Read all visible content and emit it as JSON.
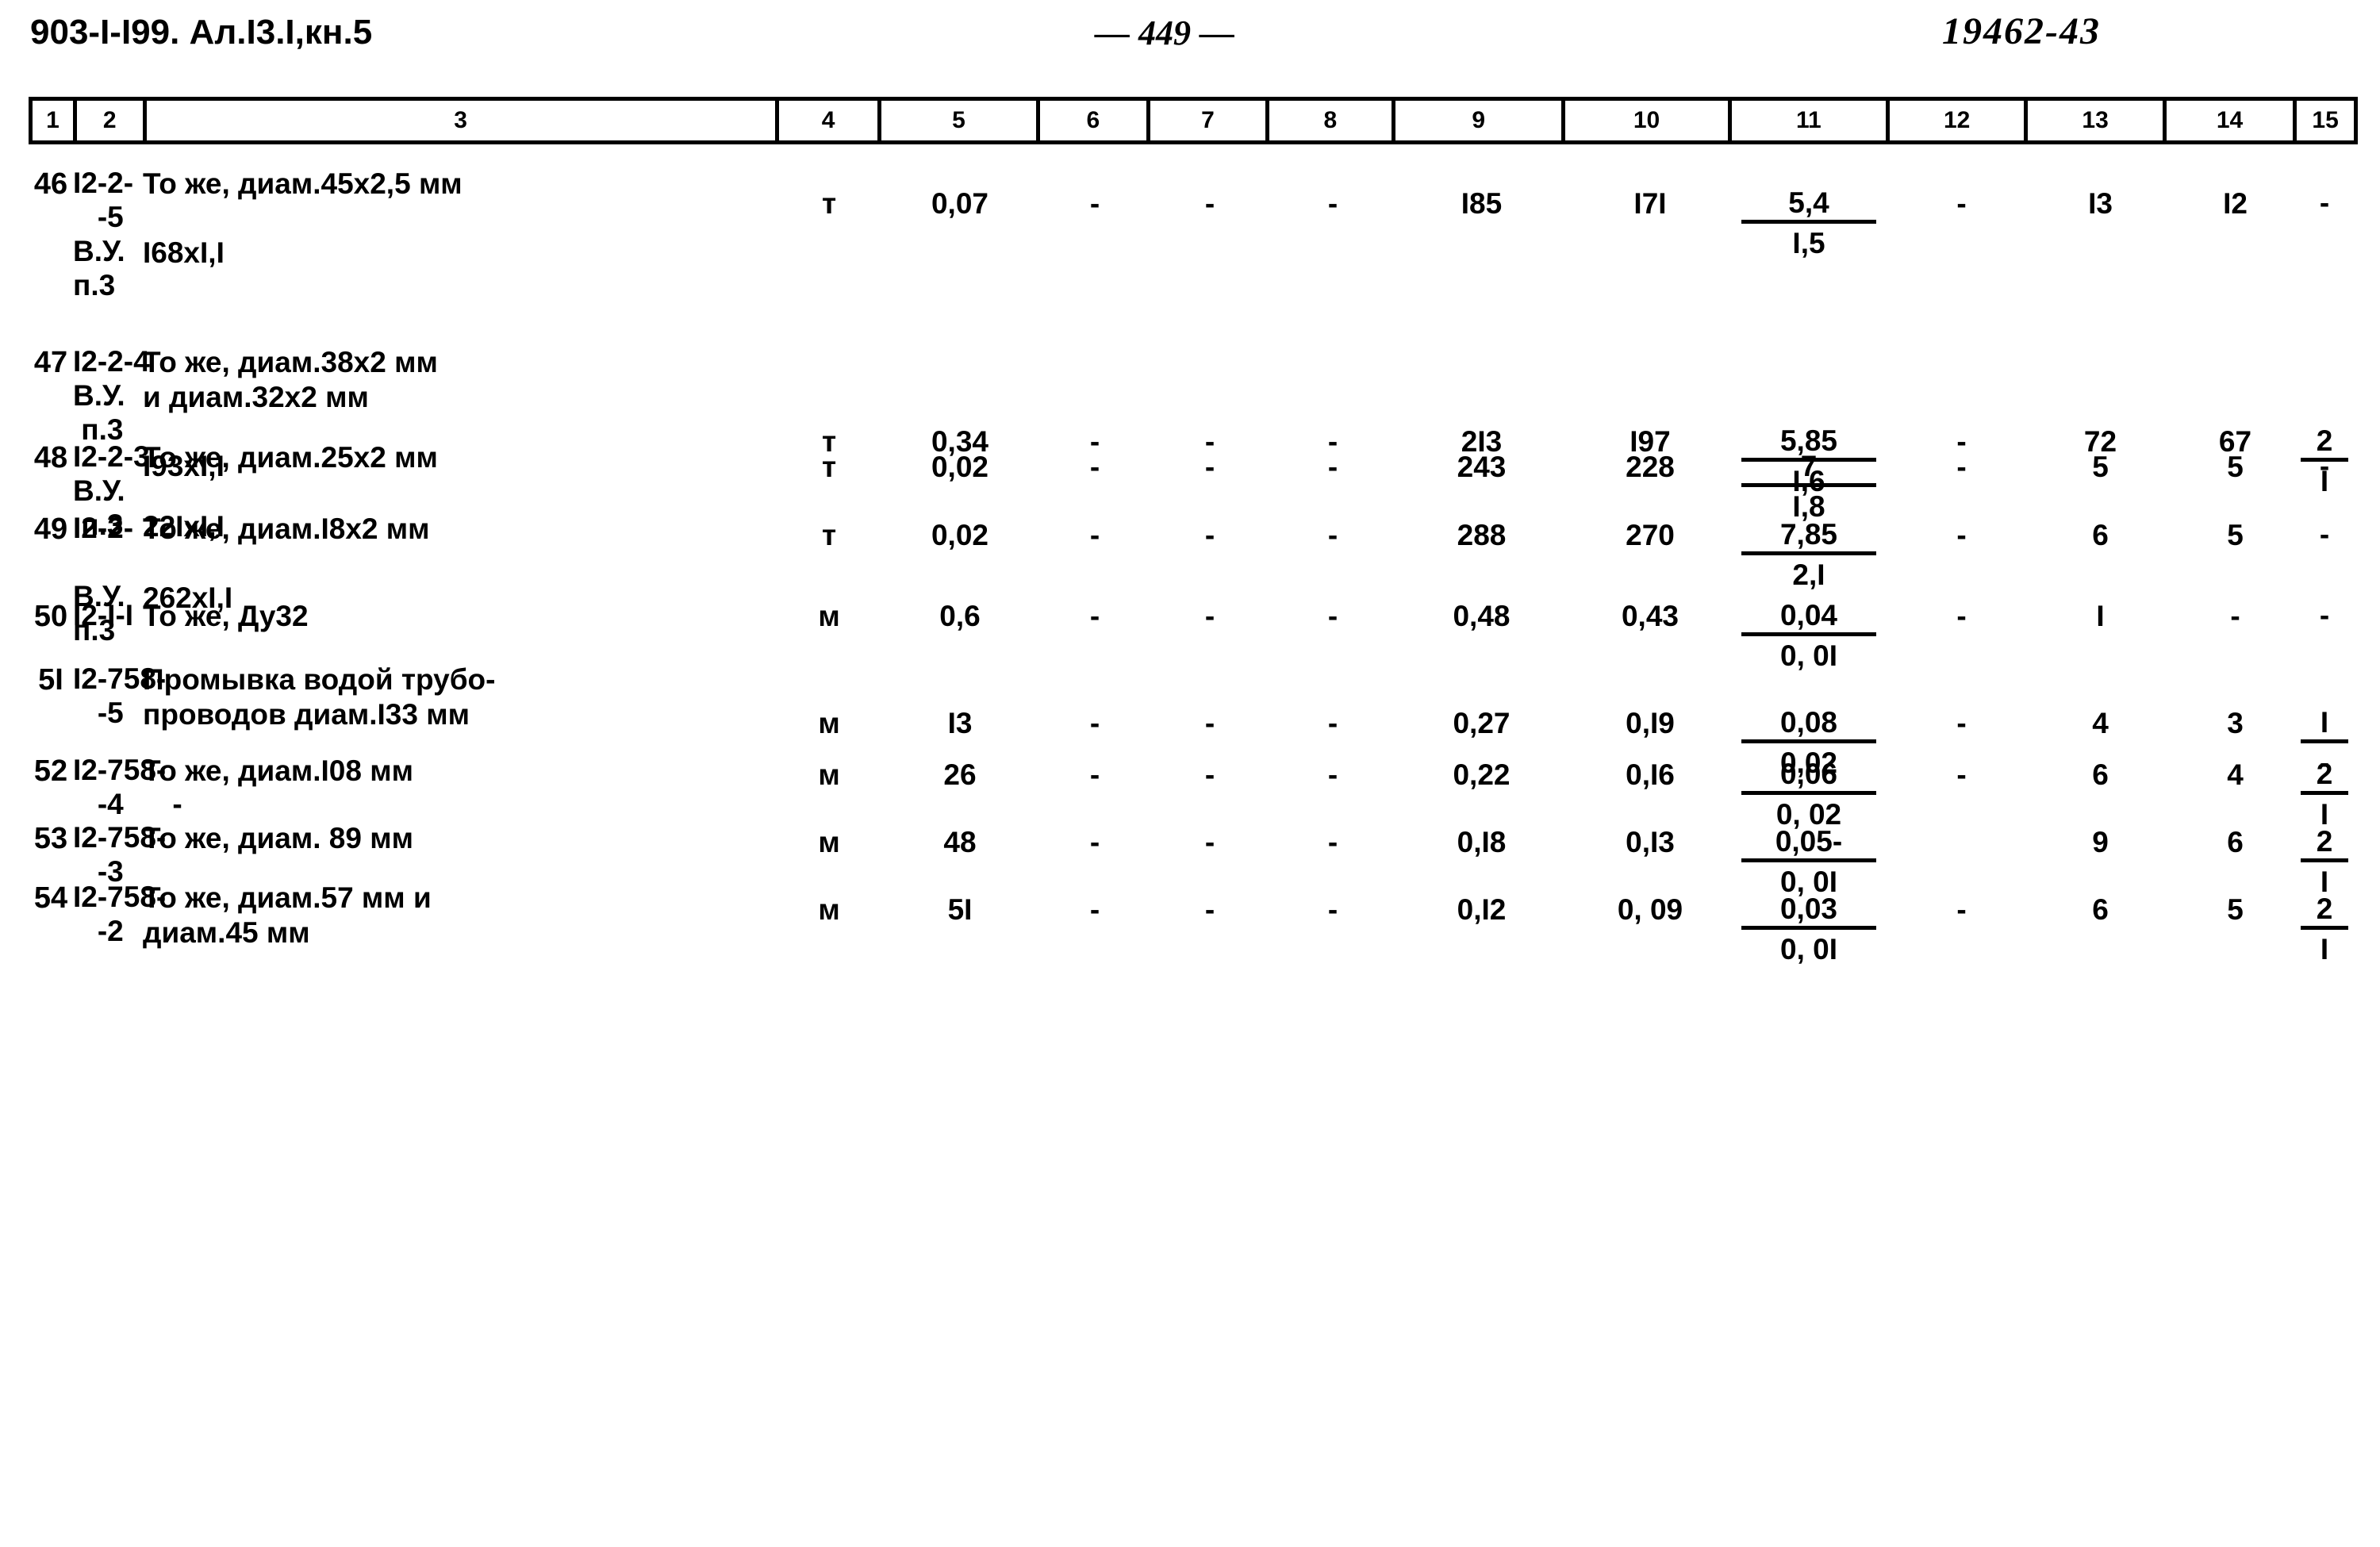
{
  "header": {
    "doc_code": "903-I-I99. Ал.I3.I,кн.5",
    "page_number": "— 449 —",
    "stamp": "19462-43"
  },
  "table": {
    "column_numbers": [
      "1",
      "2",
      "3",
      "4",
      "5",
      "6",
      "7",
      "8",
      "9",
      "10",
      "11",
      "12",
      "13",
      "14",
      "15"
    ],
    "rows": [
      {
        "n": "46",
        "code": "I2-2-\n   -5\nВ.У.\nп.3",
        "desc": "То же, диам.45х2,5 мм\n\nI68хI,I",
        "unit": "т",
        "c5": "0,07",
        "c6": "-",
        "c7": "-",
        "c8": "-",
        "c9": "I85",
        "c10": "I7I",
        "c11_top": "5,4",
        "c11_bot": "I,5",
        "c12": "-",
        "c13": "I3",
        "c14": "I2",
        "c15_top": "-",
        "c15_bot": ""
      },
      {
        "n": "47",
        "code": "I2-2-4\nВ.У.\n п.3",
        "desc": "То же, диам.38х2 мм\nи диам.32х2 мм\n\nI93хI,I",
        "unit": "т",
        "c5": "0,34",
        "c6": "-",
        "c7": "-",
        "c8": "-",
        "c9": "2I3",
        "c10": "I97",
        "c11_top": "5,85",
        "c11_bot": "I,6",
        "c12": "-",
        "c13": "72",
        "c14": "67",
        "c15_top": "2",
        "c15_bot": "I"
      },
      {
        "n": "48",
        "code": "I2-2-3\nВ.У.\n п.3",
        "desc": "То же, диам.25х2 мм\n\n22IхI,I",
        "unit": "т",
        "c5": "0,02",
        "c6": "-",
        "c7": "-",
        "c8": "-",
        "c9": "243",
        "c10": "228",
        "c11_top": "7",
        "c11_bot": "I,8",
        "c12": "-",
        "c13": "5",
        "c14": "5",
        "c15_top": "-",
        "c15_bot": ""
      },
      {
        "n": "49",
        "code": "I2-2-\n\nВ.У.\nп.3",
        "desc": "То же, диам.I8х2 мм\n\n262хI,I",
        "unit": "т",
        "c5": "0,02",
        "c6": "-",
        "c7": "-",
        "c8": "-",
        "c9": "288",
        "c10": "270",
        "c11_top": "7,85",
        "c11_bot": "2,I",
        "c12": "-",
        "c13": "6",
        "c14": "5",
        "c15_top": "-",
        "c15_bot": ""
      },
      {
        "n": "50",
        "code": "I2-I-I",
        "desc": "То же, Ду32",
        "unit": "м",
        "c5": "0,6",
        "c6": "-",
        "c7": "-",
        "c8": "-",
        "c9": "0,48",
        "c10": "0,43",
        "c11_top": "0,04",
        "c11_bot": "0, 0I",
        "c12": "-",
        "c13": "I",
        "c14": "-",
        "c15_top": "-",
        "c15_bot": ""
      },
      {
        "n": "5I",
        "code": "I2-758-\n   -5",
        "desc": "Промывка водой трубо-\nпроводов диам.I33 мм",
        "unit": "м",
        "c5": "I3",
        "c6": "-",
        "c7": "-",
        "c8": "-",
        "c9": "0,27",
        "c10": "0,I9",
        "c11_top": "0,08",
        "c11_bot": "0,02",
        "c12": "-",
        "c13": "4",
        "c14": "3",
        "c15_top": "I",
        "c15_bot": "-"
      },
      {
        "n": "52",
        "code": "I2-758-\n   -4      -",
        "desc": "То же, диам.I08 мм",
        "unit": "м",
        "c5": "26",
        "c6": "-",
        "c7": "-",
        "c8": "-",
        "c9": "0,22",
        "c10": "0,I6",
        "c11_top": "0,06",
        "c11_bot": "0, 02",
        "c12": "-",
        "c13": "6",
        "c14": "4",
        "c15_top": "2",
        "c15_bot": "I"
      },
      {
        "n": "53",
        "code": "I2-758-\n   -3",
        "desc": "То же, диам. 89 мм",
        "unit": "м",
        "c5": "48",
        "c6": "-",
        "c7": "-",
        "c8": "-",
        "c9": "0,I8",
        "c10": "0,I3",
        "c11_top": "0,05-",
        "c11_bot": "0, 0I",
        "c12": "",
        "c13": "9",
        "c14": "6",
        "c15_top": "2",
        "c15_bot": "I"
      },
      {
        "n": "54",
        "code": "I2-758-\n   -2",
        "desc": "То же, диам.57 мм и\nдиам.45 мм",
        "unit": "м",
        "c5": "5I",
        "c6": "-",
        "c7": "-",
        "c8": "-",
        "c9": "0,I2",
        "c10": "0, 09",
        "c11_top": "0,03",
        "c11_bot": "0, 0I",
        "c12": "-",
        "c13": "6",
        "c14": "5",
        "c15_top": "2",
        "c15_bot": "I"
      }
    ]
  }
}
